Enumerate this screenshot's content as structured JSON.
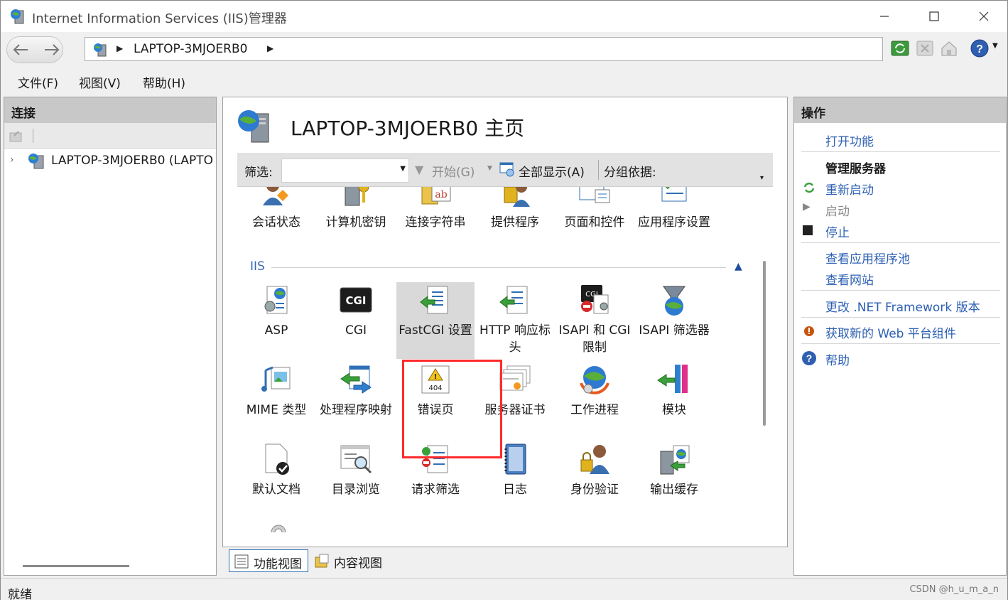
{
  "window": {
    "title": "Internet Information Services (IIS)管理器"
  },
  "address": {
    "crumb": "LAPTOP-3MJOERB0"
  },
  "menu": {
    "file": "文件(F)",
    "view": "视图(V)",
    "help": "帮助(H)"
  },
  "connections": {
    "header": "连接",
    "tree_root": "LAPTOP-3MJOERB0 (LAPTO"
  },
  "home": {
    "title": "LAPTOP-3MJOERB0 主页",
    "filter_label": "筛选:",
    "start_label": "开始(G)",
    "show_all_label": "全部显示(A)",
    "group_label": "分组依据:"
  },
  "features_top": [
    {
      "label": "会话状态",
      "icon": "session-state-icon"
    },
    {
      "label": "计算机密钥",
      "icon": "machine-key-icon"
    },
    {
      "label": "连接字符串",
      "icon": "connection-strings-icon"
    },
    {
      "label": "提供程序",
      "icon": "providers-icon"
    },
    {
      "label": "页面和控件",
      "icon": "pages-controls-icon"
    },
    {
      "label": "应用程序设置",
      "icon": "app-settings-icon"
    }
  ],
  "iis_section": {
    "label": "IIS"
  },
  "features_iis": [
    {
      "label": "ASP",
      "icon": "asp-icon"
    },
    {
      "label": "CGI",
      "icon": "cgi-icon"
    },
    {
      "label": "FastCGI 设置",
      "icon": "fastcgi-icon"
    },
    {
      "label": "HTTP 响应标头",
      "icon": "http-headers-icon"
    },
    {
      "label": "ISAPI 和 CGI 限制",
      "icon": "isapi-cgi-icon"
    },
    {
      "label": "ISAPI 筛选器",
      "icon": "isapi-filter-icon"
    },
    {
      "label": "MIME 类型",
      "icon": "mime-icon"
    },
    {
      "label": "处理程序映射",
      "icon": "handler-icon"
    },
    {
      "label": "错误页",
      "icon": "error-pages-icon"
    },
    {
      "label": "服务器证书",
      "icon": "certificates-icon"
    },
    {
      "label": "工作进程",
      "icon": "worker-process-icon"
    },
    {
      "label": "模块",
      "icon": "modules-icon"
    },
    {
      "label": "默认文档",
      "icon": "default-doc-icon"
    },
    {
      "label": "目录浏览",
      "icon": "dir-browse-icon"
    },
    {
      "label": "请求筛选",
      "icon": "request-filter-icon"
    },
    {
      "label": "日志",
      "icon": "logging-icon"
    },
    {
      "label": "身份验证",
      "icon": "auth-icon"
    },
    {
      "label": "输出缓存",
      "icon": "output-cache-icon"
    }
  ],
  "tabs": {
    "features": "功能视图",
    "content": "内容视图"
  },
  "actions": {
    "header": "操作",
    "open_feature": "打开功能",
    "manage_server": "管理服务器",
    "restart": "重新启动",
    "start": "启动",
    "stop": "停止",
    "view_app_pools": "查看应用程序池",
    "view_sites": "查看网站",
    "change_net": "更改 .NET Framework 版本",
    "get_web": "获取新的 Web 平台组件",
    "help": "帮助"
  },
  "status": {
    "text": "就绪",
    "watermark": "CSDN @h_u_m_a_n"
  }
}
